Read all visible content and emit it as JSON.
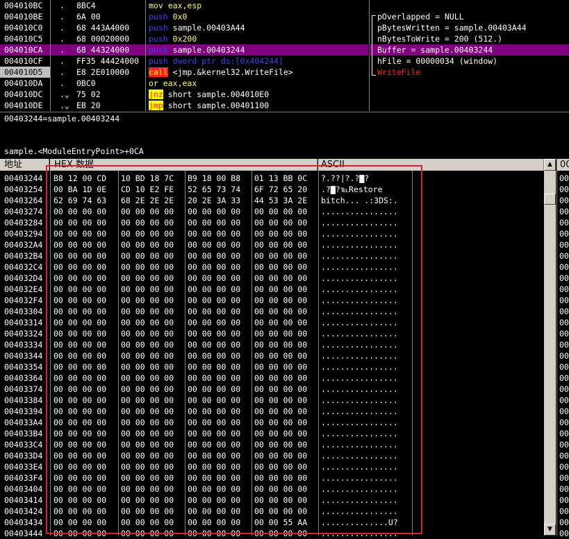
{
  "disasm": {
    "rows": [
      {
        "addr": "004010BC",
        "mark": ".",
        "bytes": "8BC4",
        "cmd": "mov",
        "cmdclass": "c-mov",
        "op": "eax,esp",
        "opclass": "op"
      },
      {
        "addr": "004010BE",
        "mark": ".",
        "bytes": "6A 00",
        "cmd": "push",
        "cmdclass": "c-push",
        "op": "0x0",
        "opclass": "op"
      },
      {
        "addr": "004010C0",
        "mark": ".",
        "bytes": "68 443A4000",
        "cmd": "push",
        "cmdclass": "c-push",
        "op": "sample.00403A44",
        "opclass": "op-w"
      },
      {
        "addr": "004010C5",
        "mark": ".",
        "bytes": "68 00020000",
        "cmd": "push",
        "cmdclass": "c-push",
        "op": "0x200",
        "opclass": "op"
      },
      {
        "addr": "004010CA",
        "mark": ".",
        "bytes": "68 44324000",
        "cmd": "push",
        "cmdclass": "c-push",
        "op": "sample.00403244",
        "opclass": "op-w",
        "highlight": true
      },
      {
        "addr": "004010CF",
        "mark": ".",
        "bytes": "FF35 44424000",
        "cmd": "push",
        "cmdclass": "c-push",
        "op": "dword ptr ds:[0x404244]",
        "opclass": "c-push"
      },
      {
        "addr": "004010D5",
        "mark": ".",
        "bytes": "E8 2E010000",
        "cmd": "call",
        "cmdclass": "c-call",
        "op": "<jmp.&kernel32.WriteFile>",
        "opclass": "op-w",
        "selected": true
      },
      {
        "addr": "004010DA",
        "mark": ".",
        "bytes": "0BC0",
        "cmd": "or",
        "cmdclass": "c-or",
        "op": "eax,eax",
        "opclass": "op"
      },
      {
        "addr": "004010DC",
        "mark": ".⌄",
        "bytes": "75 02",
        "cmd": "jnz",
        "cmdclass": "c-jmp",
        "op": "short sample.004010E0",
        "opclass": "op-w"
      },
      {
        "addr": "004010DE",
        "mark": ".⌄",
        "bytes": "EB 20",
        "cmd": "jmp",
        "cmdclass": "c-jmp",
        "op": "short sample.00401100",
        "opclass": "op-w"
      }
    ]
  },
  "comments": [
    {
      "text": "pOverlapped = NULL",
      "red": false
    },
    {
      "text": "pBytesWritten = sample.00403A44",
      "red": false
    },
    {
      "text": "nBytesToWrite = 200 (512.)",
      "red": false
    },
    {
      "text": "Buffer = sample.00403244",
      "red": false,
      "highlight": true
    },
    {
      "text": "hFile = 00000034 (window)",
      "red": false
    },
    {
      "text": "WriteFile",
      "red": true
    }
  ],
  "info": {
    "line1": "00403244=sample.00403244",
    "line2": "sample.<ModuleEntryPoint>+0CA"
  },
  "dump": {
    "header_addr": "地址",
    "header_hex": "HEX 数据",
    "header_ascii": "ASCII",
    "rows": [
      {
        "addr": "00403244",
        "hex": "B8 12 00 CD|10 BD 18 7C|B9 18 00 B8|01 13 BB 0C",
        "ascii": "?.??|?.?▇?"
      },
      {
        "addr": "00403254",
        "hex": "00 BA 1D 0E|CD 10 E2 FE|52 65 73 74|6F 72 65 20",
        "ascii": ".?▇?℡Restore "
      },
      {
        "addr": "00403264",
        "hex": "62 69 74 63|68 2E 2E 2E|20 2E 3A 33|44 53 3A 2E",
        "ascii": "bitch... .:3DS:."
      },
      {
        "addr": "00403274",
        "hex": "00 00 00 00|00 00 00 00|00 00 00 00|00 00 00 00",
        "ascii": "................"
      },
      {
        "addr": "00403284",
        "hex": "00 00 00 00|00 00 00 00|00 00 00 00|00 00 00 00",
        "ascii": "................"
      },
      {
        "addr": "00403294",
        "hex": "00 00 00 00|00 00 00 00|00 00 00 00|00 00 00 00",
        "ascii": "................"
      },
      {
        "addr": "004032A4",
        "hex": "00 00 00 00|00 00 00 00|00 00 00 00|00 00 00 00",
        "ascii": "................"
      },
      {
        "addr": "004032B4",
        "hex": "00 00 00 00|00 00 00 00|00 00 00 00|00 00 00 00",
        "ascii": "................"
      },
      {
        "addr": "004032C4",
        "hex": "00 00 00 00|00 00 00 00|00 00 00 00|00 00 00 00",
        "ascii": "................"
      },
      {
        "addr": "004032D4",
        "hex": "00 00 00 00|00 00 00 00|00 00 00 00|00 00 00 00",
        "ascii": "................"
      },
      {
        "addr": "004032E4",
        "hex": "00 00 00 00|00 00 00 00|00 00 00 00|00 00 00 00",
        "ascii": "................"
      },
      {
        "addr": "004032F4",
        "hex": "00 00 00 00|00 00 00 00|00 00 00 00|00 00 00 00",
        "ascii": "................"
      },
      {
        "addr": "00403304",
        "hex": "00 00 00 00|00 00 00 00|00 00 00 00|00 00 00 00",
        "ascii": "................"
      },
      {
        "addr": "00403314",
        "hex": "00 00 00 00|00 00 00 00|00 00 00 00|00 00 00 00",
        "ascii": "................"
      },
      {
        "addr": "00403324",
        "hex": "00 00 00 00|00 00 00 00|00 00 00 00|00 00 00 00",
        "ascii": "................"
      },
      {
        "addr": "00403334",
        "hex": "00 00 00 00|00 00 00 00|00 00 00 00|00 00 00 00",
        "ascii": "................"
      },
      {
        "addr": "00403344",
        "hex": "00 00 00 00|00 00 00 00|00 00 00 00|00 00 00 00",
        "ascii": "................"
      },
      {
        "addr": "00403354",
        "hex": "00 00 00 00|00 00 00 00|00 00 00 00|00 00 00 00",
        "ascii": "................"
      },
      {
        "addr": "00403364",
        "hex": "00 00 00 00|00 00 00 00|00 00 00 00|00 00 00 00",
        "ascii": "................"
      },
      {
        "addr": "00403374",
        "hex": "00 00 00 00|00 00 00 00|00 00 00 00|00 00 00 00",
        "ascii": "................"
      },
      {
        "addr": "00403384",
        "hex": "00 00 00 00|00 00 00 00|00 00 00 00|00 00 00 00",
        "ascii": "................"
      },
      {
        "addr": "00403394",
        "hex": "00 00 00 00|00 00 00 00|00 00 00 00|00 00 00 00",
        "ascii": "................"
      },
      {
        "addr": "004033A4",
        "hex": "00 00 00 00|00 00 00 00|00 00 00 00|00 00 00 00",
        "ascii": "................"
      },
      {
        "addr": "004033B4",
        "hex": "00 00 00 00|00 00 00 00|00 00 00 00|00 00 00 00",
        "ascii": "................"
      },
      {
        "addr": "004033C4",
        "hex": "00 00 00 00|00 00 00 00|00 00 00 00|00 00 00 00",
        "ascii": "................"
      },
      {
        "addr": "004033D4",
        "hex": "00 00 00 00|00 00 00 00|00 00 00 00|00 00 00 00",
        "ascii": "................"
      },
      {
        "addr": "004033E4",
        "hex": "00 00 00 00|00 00 00 00|00 00 00 00|00 00 00 00",
        "ascii": "................"
      },
      {
        "addr": "004033F4",
        "hex": "00 00 00 00|00 00 00 00|00 00 00 00|00 00 00 00",
        "ascii": "................"
      },
      {
        "addr": "00403404",
        "hex": "00 00 00 00|00 00 00 00|00 00 00 00|00 00 00 00",
        "ascii": "................"
      },
      {
        "addr": "00403414",
        "hex": "00 00 00 00|00 00 00 00|00 00 00 00|00 00 00 00",
        "ascii": "................"
      },
      {
        "addr": "00403424",
        "hex": "00 00 00 00|00 00 00 00|00 00 00 00|00 00 00 00",
        "ascii": "................"
      },
      {
        "addr": "00403434",
        "hex": "00 00 00 00|00 00 00 00|00 00 00 00|00 00 55 AA",
        "ascii": "..............U?"
      },
      {
        "addr": "00403444",
        "hex": "00 00 00 00|00 00 00 00|00 00 00 00|00 00 00 00",
        "ascii": "................"
      }
    ]
  },
  "stack": {
    "header": "00",
    "rows": [
      "00",
      "00",
      "00",
      "00",
      "00",
      "00",
      "00",
      "00",
      "00",
      "00",
      "00",
      "00",
      "00",
      "00",
      "00",
      "00",
      "00",
      "00",
      "00",
      "00",
      "00",
      "00",
      "00",
      "00",
      "00",
      "00",
      "00",
      "00",
      "00",
      "00",
      "00",
      "00",
      "00"
    ]
  },
  "scroll": {
    "up": "▲",
    "down": "▼"
  },
  "colors": {
    "highlight": "#800080",
    "push": "#4040ff",
    "call_bg": "#ff2020",
    "jump_bg": "#ffff00",
    "yellow": "#ffff60",
    "annotation": "#e02020",
    "panel": "#d4d0c8"
  }
}
